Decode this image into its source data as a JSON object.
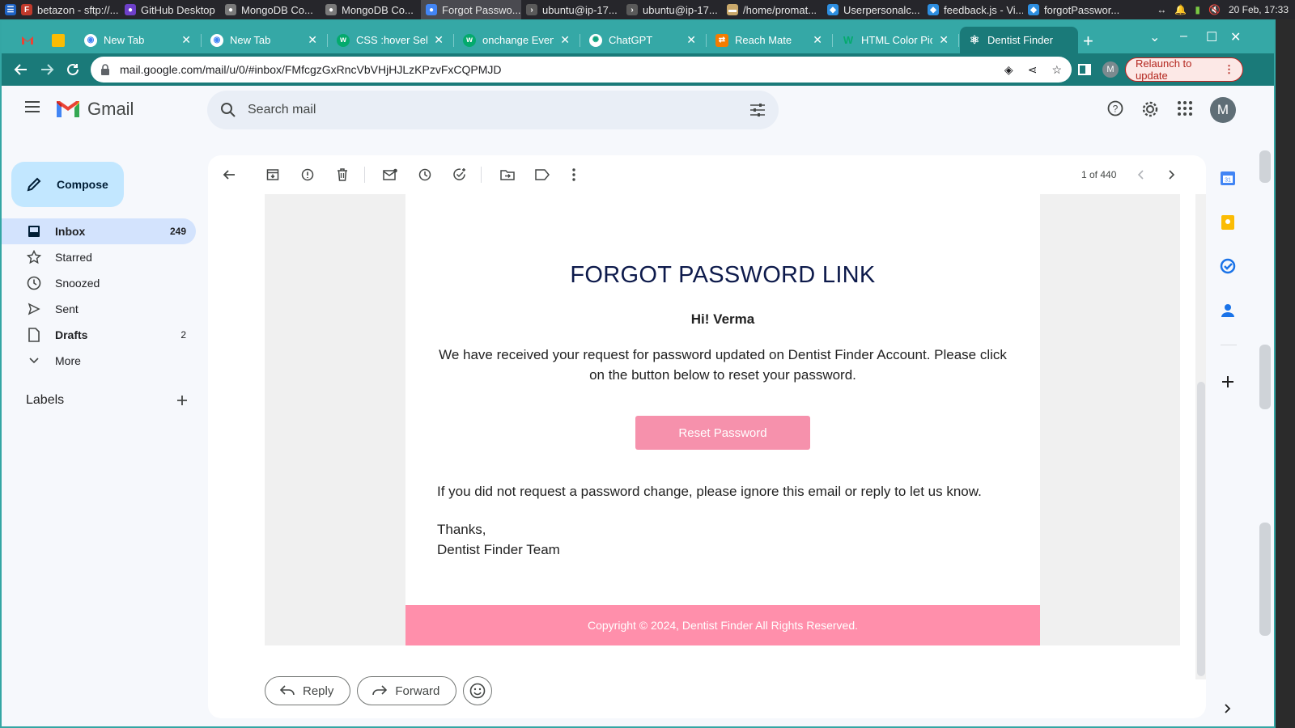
{
  "os": {
    "tasks": [
      {
        "label": "betazon - sftp://...",
        "color": "#c0392b"
      },
      {
        "label": "GitHub Desktop",
        "color": "#6e40c9"
      },
      {
        "label": "MongoDB Co...",
        "color": "#7a7a7a"
      },
      {
        "label": "MongoDB Co...",
        "color": "#7a7a7a"
      },
      {
        "label": "Forgot Passwo...",
        "color": "#4285f4"
      },
      {
        "label": "ubuntu@ip-17...",
        "color": "#5a5a5a"
      },
      {
        "label": "ubuntu@ip-17...",
        "color": "#5a5a5a"
      },
      {
        "label": "/home/promat...",
        "color": "#c9a86a"
      },
      {
        "label": "Userpersonalc...",
        "color": "#2d8ee0"
      },
      {
        "label": "feedback.js - Vi...",
        "color": "#2d8ee0"
      },
      {
        "label": "forgotPasswor...",
        "color": "#2d8ee0"
      }
    ],
    "datetime": "20 Feb, 17:33"
  },
  "browser": {
    "tabs": [
      {
        "label": "",
        "icon": "gmail-icon"
      },
      {
        "label": "",
        "icon": "drive-icon"
      },
      {
        "label": "New Tab",
        "icon": "chrome-icon"
      },
      {
        "label": "New Tab",
        "icon": "chrome-icon"
      },
      {
        "label": "CSS :hover Sele",
        "icon": "w3-icon"
      },
      {
        "label": "onchange Event",
        "icon": "w3-icon"
      },
      {
        "label": "ChatGPT",
        "icon": "chatgpt-icon"
      },
      {
        "label": "Reach Mate",
        "icon": "reachmate-icon"
      },
      {
        "label": "HTML Color Pick",
        "icon": "w3-icon"
      },
      {
        "label": "Dentist Finder",
        "icon": "react-icon"
      }
    ],
    "url": "mail.google.com/mail/u/0/#inbox/FMfcgzGxRncVbVHjHJLzKPzvFxCQPMJD",
    "relaunch_label": "Relaunch to update",
    "profile_initial": "M"
  },
  "gmail": {
    "brand": "Gmail",
    "search_placeholder": "Search mail",
    "avatar_initial": "M",
    "compose_label": "Compose",
    "nav": [
      {
        "label": "Inbox",
        "count": "249",
        "icon": "inbox-icon"
      },
      {
        "label": "Starred",
        "count": "",
        "icon": "star-icon"
      },
      {
        "label": "Snoozed",
        "count": "",
        "icon": "clock-icon"
      },
      {
        "label": "Sent",
        "count": "",
        "icon": "send-icon"
      },
      {
        "label": "Drafts",
        "count": "2",
        "icon": "draft-icon"
      },
      {
        "label": "More",
        "count": "",
        "icon": "chevron-down-icon"
      }
    ],
    "labels_heading": "Labels",
    "pager": "1 of 440"
  },
  "email": {
    "title": "FORGOT PASSWORD LINK",
    "greeting": "Hi! Verma",
    "body1": "We have received your request for password updated on Dentist Finder Account. Please click on the button below to reset your password.",
    "button_label": "Reset Password",
    "body2": "If you did not request a password change, please ignore this email or reply to let us know.",
    "sign_thanks": "Thanks,",
    "sign_team": "Dentist Finder Team",
    "footer": "Copyright © 2024, Dentist Finder All Rights Reserved.",
    "button_color": "#f691ac",
    "footer_color": "#ff8fab"
  },
  "actions": {
    "reply_label": "Reply",
    "forward_label": "Forward"
  }
}
